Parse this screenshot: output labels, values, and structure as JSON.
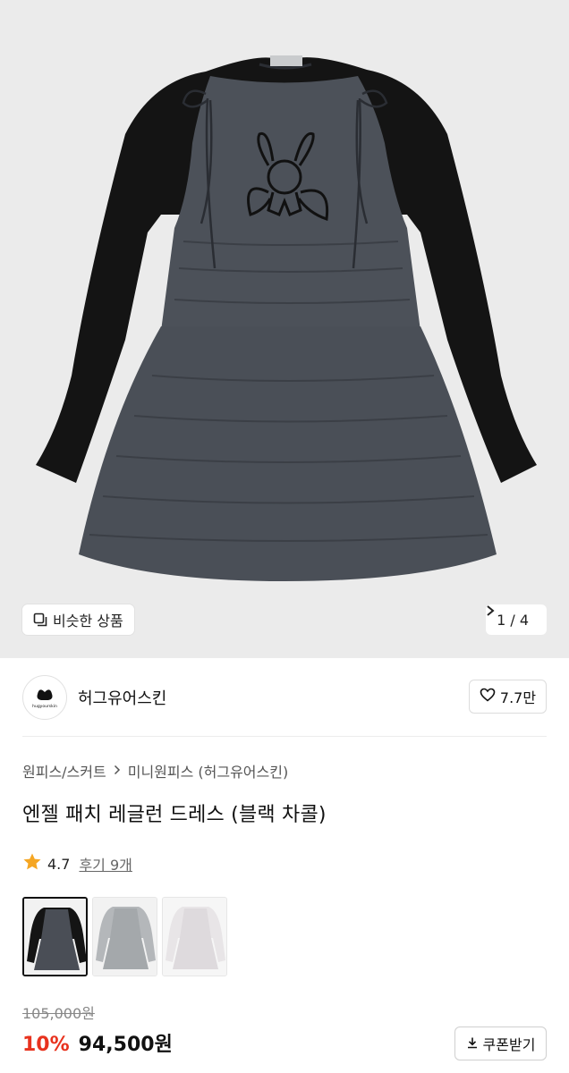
{
  "gallery": {
    "similar_label": "비슷한 상품",
    "similar_icon": "similar-items-icon",
    "pager": "1 / 4",
    "next_icon": "chevron-right-icon"
  },
  "brand": {
    "logo_text": "hugyourskin",
    "name": "허그유어스킨",
    "like_count": "7.7만",
    "like_icon": "heart-icon"
  },
  "breadcrumb": [
    "원피스/스커트",
    "미니원피스 (허그유어스킨)"
  ],
  "product": {
    "title": "엔젤 패치 레글런 드레스 (블랙 차콜)",
    "rating": "4.7",
    "review_label": "후기 9개",
    "star_color": "#f5a623"
  },
  "options": [
    {
      "name": "블랙 차콜",
      "color": "#4a4e56"
    },
    {
      "name": "그레이",
      "color": "#a9adb0"
    },
    {
      "name": "화이트",
      "color": "#eceaec"
    }
  ],
  "pricing": {
    "original": "105,000원",
    "discount": "10%",
    "price": "94,500원",
    "discount_color": "#e8321e",
    "coupon_label": "쿠폰받기",
    "coupon_icon": "download-icon"
  }
}
